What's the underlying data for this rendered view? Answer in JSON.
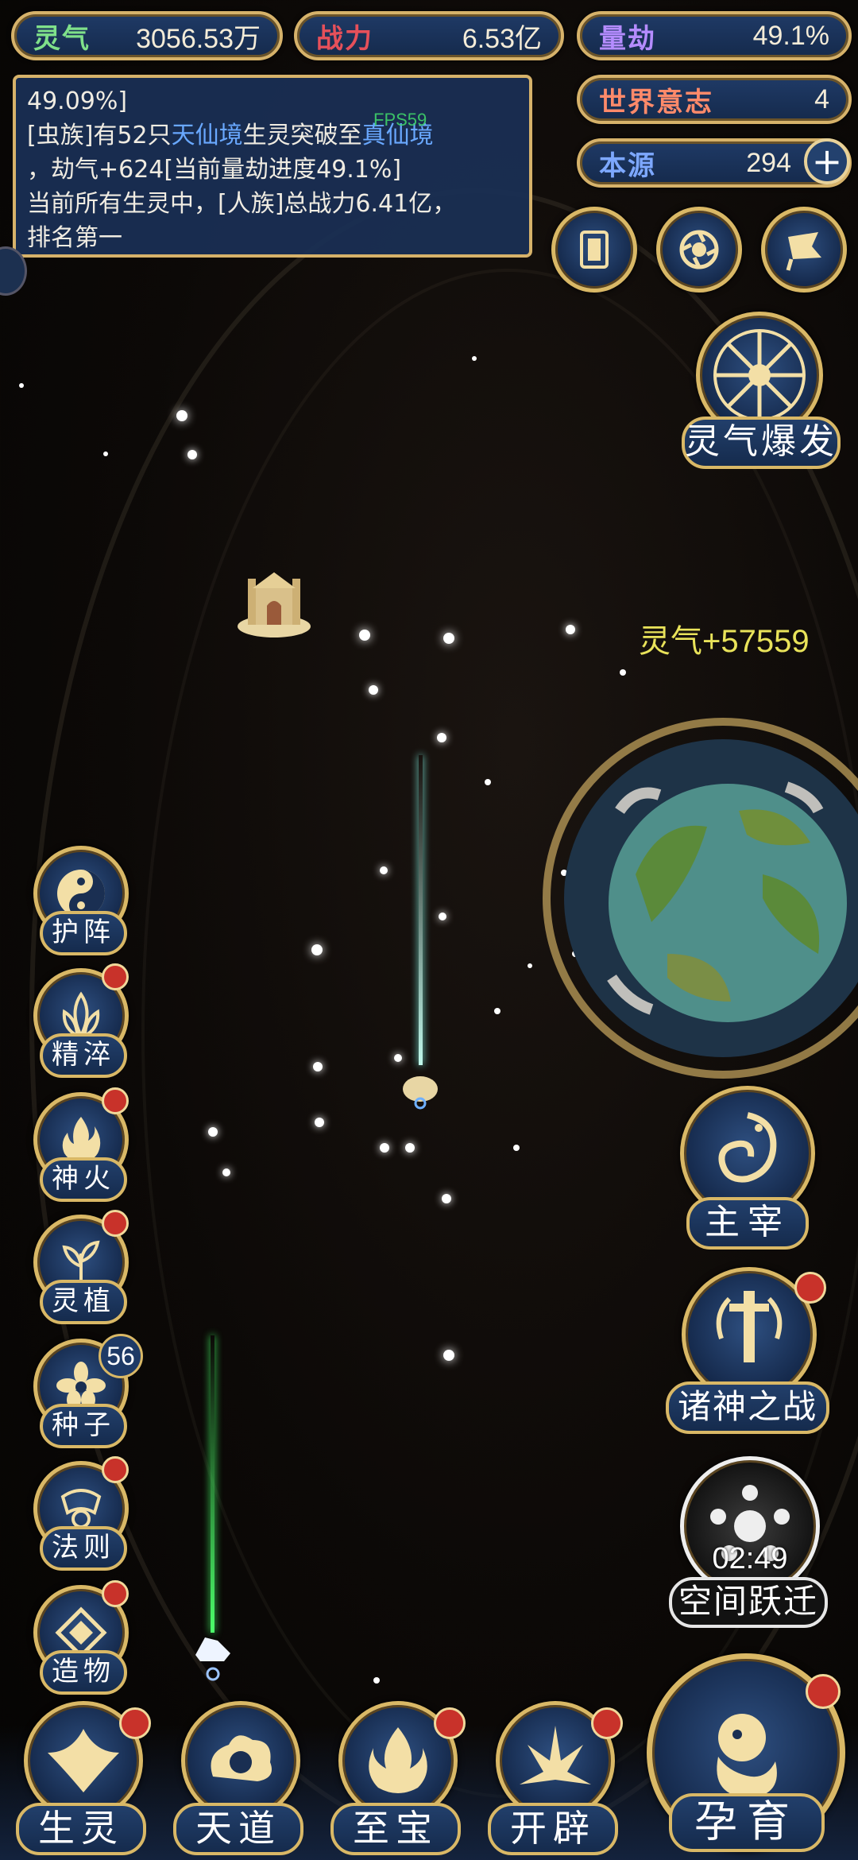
{
  "stats": {
    "lingqi": {
      "label": "灵气",
      "value": "3056.53万"
    },
    "zhanli": {
      "label": "战力",
      "value": "6.53亿"
    },
    "liangjie": {
      "label": "量劫",
      "value": "49.1%"
    },
    "shijie": {
      "label": "世界意志",
      "value": "4"
    },
    "benyuan": {
      "label": "本源",
      "value": "294"
    }
  },
  "log": {
    "line1": "49.09%]",
    "line2_a": "[虫族]有52只",
    "line2_b": "天仙境",
    "line2_c": "生灵突破至",
    "line2_d": "真仙境",
    "line3": "，劫气+624[当前量劫进度49.1%]",
    "line4": "当前所有生灵中，[人族]总战力6.41亿，",
    "line5": "排名第一"
  },
  "fps": "FPS59",
  "float_gain": "灵气+57559",
  "burst_label": "灵气爆发",
  "side_buttons": [
    {
      "label": "护阵"
    },
    {
      "label": "精淬"
    },
    {
      "label": "神火"
    },
    {
      "label": "灵植"
    },
    {
      "label": "种子",
      "badge": "56"
    },
    {
      "label": "法则"
    },
    {
      "label": "造物"
    }
  ],
  "right_buttons": {
    "master": "主宰",
    "godwar": "诸神之战",
    "jump": "空间跃迁",
    "jump_timer": "02:49"
  },
  "bottom_buttons": [
    "生灵",
    "天道",
    "至宝",
    "开辟"
  ],
  "nurture": "孕育",
  "colors": {
    "gold": "#d6b26a",
    "panel": "#1f3a66",
    "badge": "#c8322a",
    "accent_blue": "#69a8ff"
  }
}
